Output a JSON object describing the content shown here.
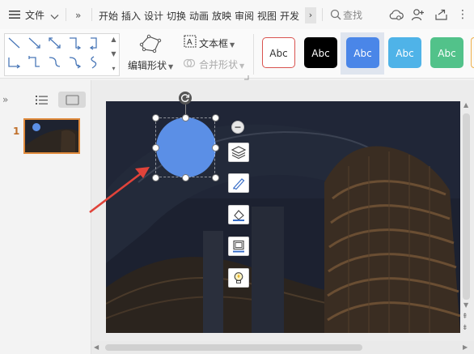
{
  "menubar": {
    "file_label": "文件",
    "tabs": [
      "开始",
      "插入",
      "设计",
      "切换",
      "动画",
      "放映",
      "审阅",
      "视图",
      "开发"
    ],
    "search_label": "查找"
  },
  "ribbon": {
    "edit_shape_label": "编辑形状",
    "textbox_label": "文本框",
    "merge_shape_label": "合并形状",
    "style_samples": [
      {
        "text": "Abc",
        "bg": "#ffffff",
        "fg": "#333333",
        "border": "#d9534f"
      },
      {
        "text": "Abc",
        "bg": "#000000",
        "fg": "#ffffff",
        "border": "#000000"
      },
      {
        "text": "Abc",
        "bg": "#4a86e8",
        "fg": "#ffffff",
        "border": "#4a86e8"
      },
      {
        "text": "Abc",
        "bg": "#4fb3e8",
        "fg": "#ffffff",
        "border": "#4fb3e8"
      },
      {
        "text": "Abc",
        "bg": "#52c28a",
        "fg": "#ffffff",
        "border": "#52c28a"
      }
    ]
  },
  "thumbnails": {
    "slide_number": "1"
  },
  "slide": {
    "circle_color": "#5b8fe6",
    "arrow_color": "#e0433a"
  },
  "float_toolbar": [
    "remove-icon",
    "layers-icon",
    "brush-icon",
    "fill-icon",
    "border-icon",
    "lightbulb-icon"
  ]
}
